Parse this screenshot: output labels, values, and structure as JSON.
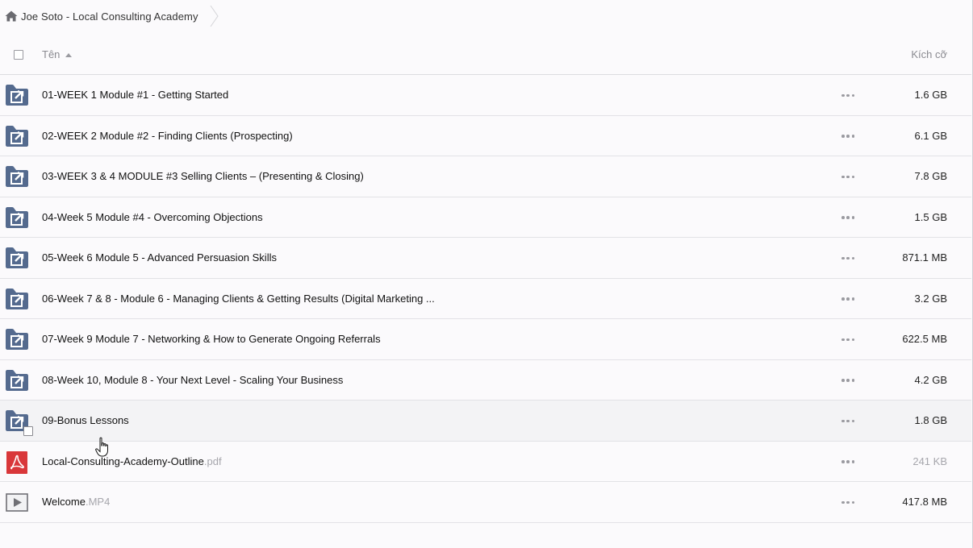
{
  "breadcrumb": {
    "label": "Joe Soto - Local Consulting Academy",
    "home_icon": "home-icon"
  },
  "header": {
    "name_label": "Tên",
    "size_label": "Kích cỡ",
    "sort_icon": "sort-ascending-icon"
  },
  "colors": {
    "folder": "#546a8e",
    "pdf": "#d9373a",
    "video_frame": "#6f6f74"
  },
  "rows": [
    {
      "name": "01-WEEK 1 Module #1 - Getting Started",
      "ext": "",
      "size": "1.6 GB",
      "icon": "shared-folder-icon"
    },
    {
      "name": "02-WEEK 2 Module #2 - Finding Clients (Prospecting)",
      "ext": "",
      "size": "6.1 GB",
      "icon": "shared-folder-icon"
    },
    {
      "name": "03-WEEK 3 & 4 MODULE #3 Selling Clients – (Presenting & Closing)",
      "ext": "",
      "size": "7.8 GB",
      "icon": "shared-folder-icon"
    },
    {
      "name": "04-Week 5 Module #4 - Overcoming Objections",
      "ext": "",
      "size": "1.5 GB",
      "icon": "shared-folder-icon"
    },
    {
      "name": "05-Week 6 Module 5 - Advanced Persuasion Skills",
      "ext": "",
      "size": "871.1 MB",
      "icon": "shared-folder-icon"
    },
    {
      "name": "06-Week 7 & 8 - Module 6 - Managing Clients & Getting Results (Digital Marketing ...",
      "ext": "",
      "size": "3.2 GB",
      "icon": "shared-folder-icon"
    },
    {
      "name": "07-Week 9 Module 7 - Networking & How to Generate Ongoing Referrals",
      "ext": "",
      "size": "622.5 MB",
      "icon": "shared-folder-icon"
    },
    {
      "name": "08-Week 10, Module 8 - Your Next Level - Scaling Your Business",
      "ext": "",
      "size": "4.2 GB",
      "icon": "shared-folder-icon"
    },
    {
      "name": "09-Bonus Lessons",
      "ext": "",
      "size": "1.8 GB",
      "icon": "shared-folder-icon"
    },
    {
      "name": "Local-Consulting-Academy-Outline",
      "ext": ".pdf",
      "size": "241 KB",
      "icon": "pdf-icon"
    },
    {
      "name": "Welcome",
      "ext": ".MP4",
      "size": "417.8 MB",
      "icon": "video-icon"
    }
  ]
}
